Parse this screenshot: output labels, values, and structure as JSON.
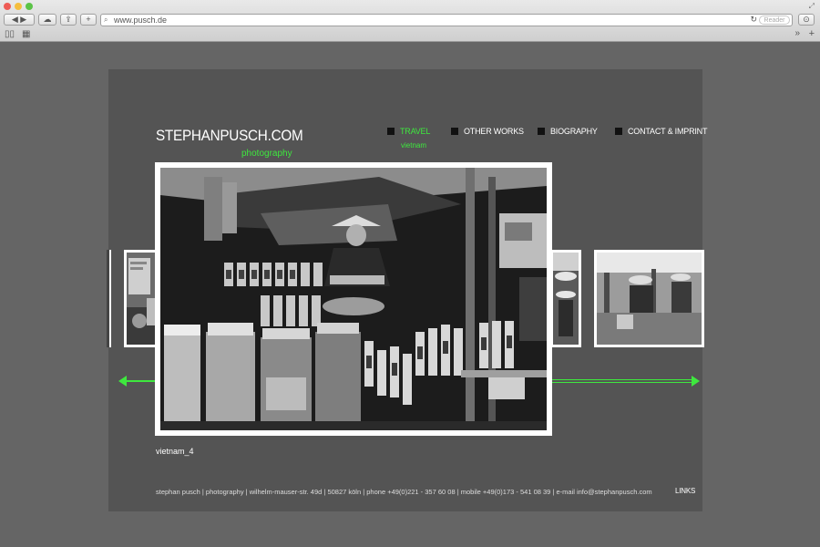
{
  "browser": {
    "url": "www.pusch.de",
    "reader_label": "Reader"
  },
  "site": {
    "title": "STEPHANPUSCH.COM",
    "subtitle": "photography"
  },
  "nav": {
    "items": [
      {
        "label": "TRAVEL"
      },
      {
        "label": "OTHER WORKS"
      },
      {
        "label": "BIOGRAPHY"
      },
      {
        "label": "CONTACT & IMPRINT"
      }
    ],
    "sub_label": "vietnam"
  },
  "gallery": {
    "caption": "vietnam_4"
  },
  "footer": {
    "text": "stephan pusch  |  photography  |  wilhelm-mauser-str. 49d  |  50827 köln  |  phone +49(0)221 - 357 60 08  |  mobile +49(0)173 - 541 08 39  |  e-mail info@stephanpusch.com",
    "links_label": "LINKS"
  },
  "colors": {
    "accent": "#3ee83e",
    "panel": "#545454",
    "background": "#656565"
  }
}
